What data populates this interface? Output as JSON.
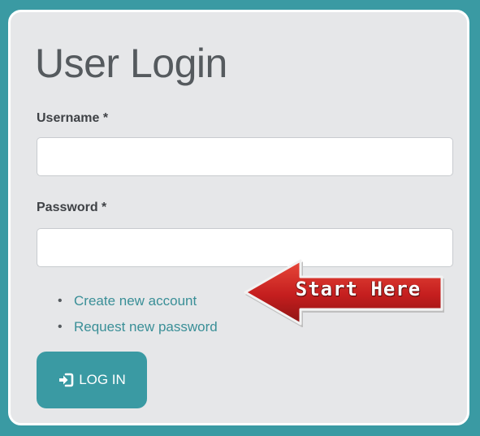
{
  "login": {
    "title": "User Login",
    "username_label": "Username",
    "password_label": "Password",
    "required_marker": "*",
    "username_value": "",
    "password_value": "",
    "links": [
      {
        "label": "Create new account"
      },
      {
        "label": "Request new password"
      }
    ],
    "login_button_label": "LOG IN",
    "login_button_icon": "sign-in-icon"
  },
  "callout": {
    "label": "Start Here",
    "icon": "left-arrow-icon",
    "color": "#c41e1e"
  },
  "colors": {
    "accent": "#3a9aa3",
    "link": "#3a8f97",
    "panel": "#e6e7e9"
  }
}
